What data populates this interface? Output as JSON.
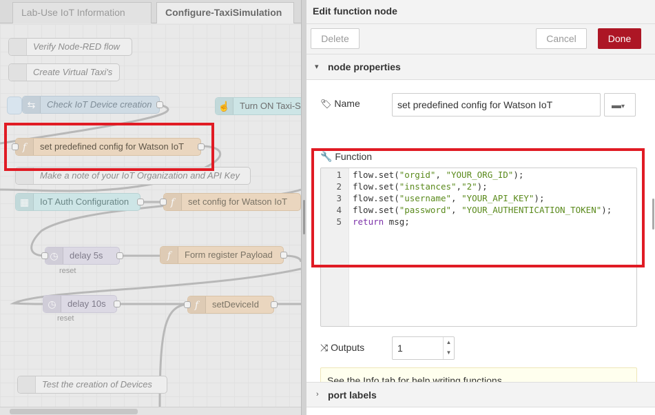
{
  "workspace": {
    "tabs": [
      "Lab-Use IoT Information",
      "Configure-TaxiSimulation"
    ],
    "active_tab_index": 1,
    "nodes": {
      "verify_comment": "Verify Node-RED flow",
      "create_comment": "Create Virtual Taxi's",
      "check_iot": "Check IoT Device creation",
      "turn_on": "Turn ON Taxi-Si",
      "set_predefined": "set predefined config for Watson IoT",
      "make_note": "Make a note of your IoT Organization and API Key",
      "iot_auth": "IoT Auth Configuration",
      "set_config": "set config for Watson IoT",
      "delay5": "delay 5s",
      "delay5_sub": "reset",
      "form_register": "Form register Payload",
      "delay10": "delay 10s",
      "delay10_sub": "reset",
      "set_device_id": "setDeviceId",
      "test_devices": "Test the creation of Devices"
    }
  },
  "tray": {
    "title": "Edit function node",
    "delete_label": "Delete",
    "cancel_label": "Cancel",
    "done_label": "Done",
    "section_node_properties": "node properties",
    "name_label": "Name",
    "name_value": "set predefined config for Watson IoT",
    "function_label": "Function",
    "code_lines": [
      {
        "n": "1",
        "pre": "flow.set(",
        "a": "\"orgid\"",
        "mid": ", ",
        "b": "\"YOUR_ORG_ID\"",
        "post": ");"
      },
      {
        "n": "2",
        "pre": "flow.set(",
        "a": "\"instances\"",
        "mid": ",",
        "b": "\"2\"",
        "post": ");"
      },
      {
        "n": "3",
        "pre": "flow.set(",
        "a": "\"username\"",
        "mid": ", ",
        "b": "\"YOUR_API_KEY\"",
        "post": ");"
      },
      {
        "n": "4",
        "pre": "flow.set(",
        "a": "\"password\"",
        "mid": ", ",
        "b": "\"YOUR_AUTHENTICATION_TOKEN\"",
        "post": ");"
      },
      {
        "n": "5",
        "kw": "return",
        "rest": " msg;"
      }
    ],
    "outputs_label": "Outputs",
    "outputs_value": "1",
    "info_tip": "See the Info tab for help writing functions.",
    "section_port_labels": "port labels"
  },
  "colors": {
    "done_button": "#ad1625",
    "highlight_box": "#e01b24",
    "function_node": "#ead6bf",
    "string_token": "#5a8a1c",
    "keyword_token": "#7b30a8"
  }
}
